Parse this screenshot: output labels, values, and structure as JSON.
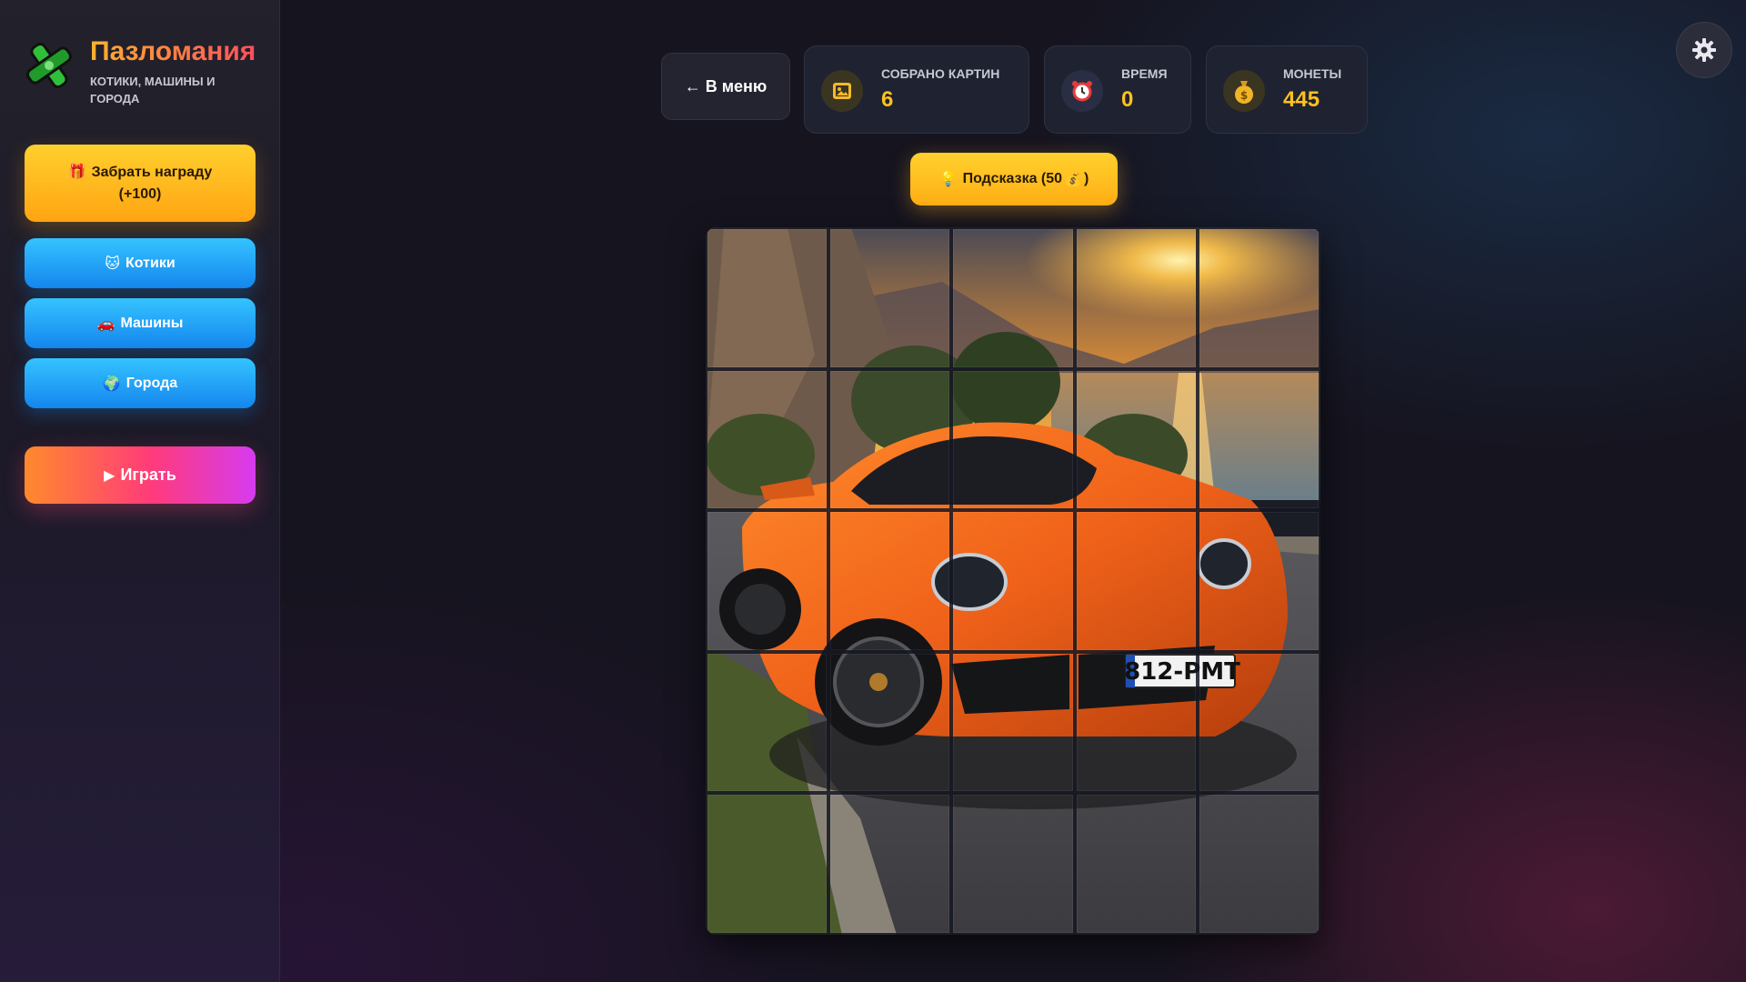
{
  "app": {
    "title": "Пазломания",
    "subtitle": "Котики, машины и города"
  },
  "sidebar": {
    "reward_button": {
      "icon": "gift-icon",
      "label_line1": "Забрать награду",
      "label_line2": "(+100)"
    },
    "categories": [
      {
        "icon": "cat-icon",
        "label": "Котики"
      },
      {
        "icon": "car-icon",
        "label": "Машины"
      },
      {
        "icon": "globe-icon",
        "label": "Города"
      }
    ],
    "play_button": {
      "icon": "play-icon",
      "label": "Играть"
    }
  },
  "topbar": {
    "menu_button": "← В меню",
    "stats": [
      {
        "icon": "picture-icon",
        "label": "Собрано картин",
        "value": "6"
      },
      {
        "icon": "alarm-clock-icon",
        "label": "Время",
        "value": "0"
      },
      {
        "icon": "money-bag-icon",
        "label": "Монеты",
        "value": "445"
      }
    ]
  },
  "hint_button": {
    "icon": "lightbulb-icon",
    "label_before": "Подсказка (50 ",
    "coin_icon": "money-bag-icon",
    "label_after": ")"
  },
  "puzzle": {
    "rows": 5,
    "cols": 5,
    "image_subject": "orange-sports-car-sunset-lake",
    "license_plate": "812-PMT"
  },
  "colors": {
    "accent_yellow": "#ffc21f",
    "category_blue": "#1e9bff",
    "play_gradient_start": "#ff8a2c",
    "play_gradient_end": "#d63bf0"
  }
}
